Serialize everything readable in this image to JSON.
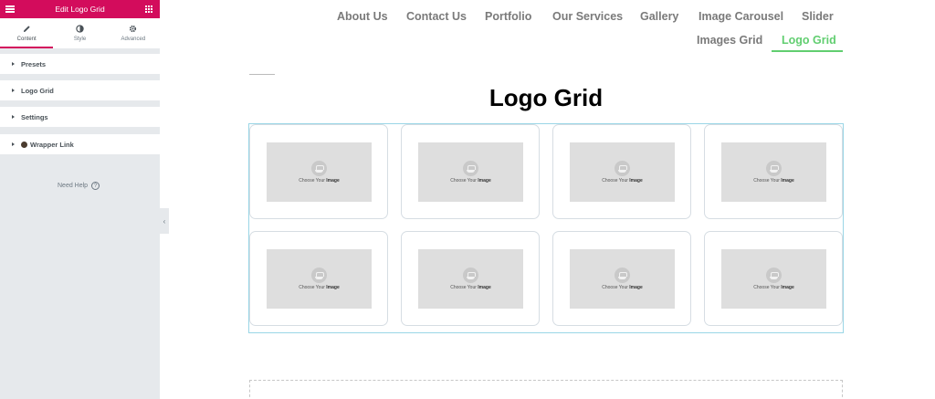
{
  "panel": {
    "title": "Edit Logo Grid",
    "tabs": [
      {
        "label": "Content",
        "icon": "pencil-icon"
      },
      {
        "label": "Style",
        "icon": "half-circle-icon"
      },
      {
        "label": "Advanced",
        "icon": "gear-icon"
      }
    ],
    "sections": [
      {
        "label": "Presets"
      },
      {
        "label": "Logo Grid"
      },
      {
        "label": "Settings"
      },
      {
        "label": "Wrapper Link",
        "icon": "emoji-icon"
      }
    ],
    "need_help": "Need Help",
    "help_icon": "?",
    "collapse_glyph": "‹",
    "accent": "#d30c5c"
  },
  "nav": {
    "items": [
      {
        "label": "About Us"
      },
      {
        "label": "Contact Us"
      },
      {
        "label": "Portfolio"
      },
      {
        "label": "Our Services"
      },
      {
        "label": "Gallery"
      },
      {
        "label": "Image Carousel"
      },
      {
        "label": "Slider"
      },
      {
        "label": "Images Grid"
      },
      {
        "label": "Logo Grid",
        "active": true
      }
    ],
    "active_color": "#61ce70"
  },
  "page": {
    "title": "Logo Grid",
    "placeholder_text": "Choose Your",
    "placeholder_bold": "Image",
    "logo_count": 8
  }
}
